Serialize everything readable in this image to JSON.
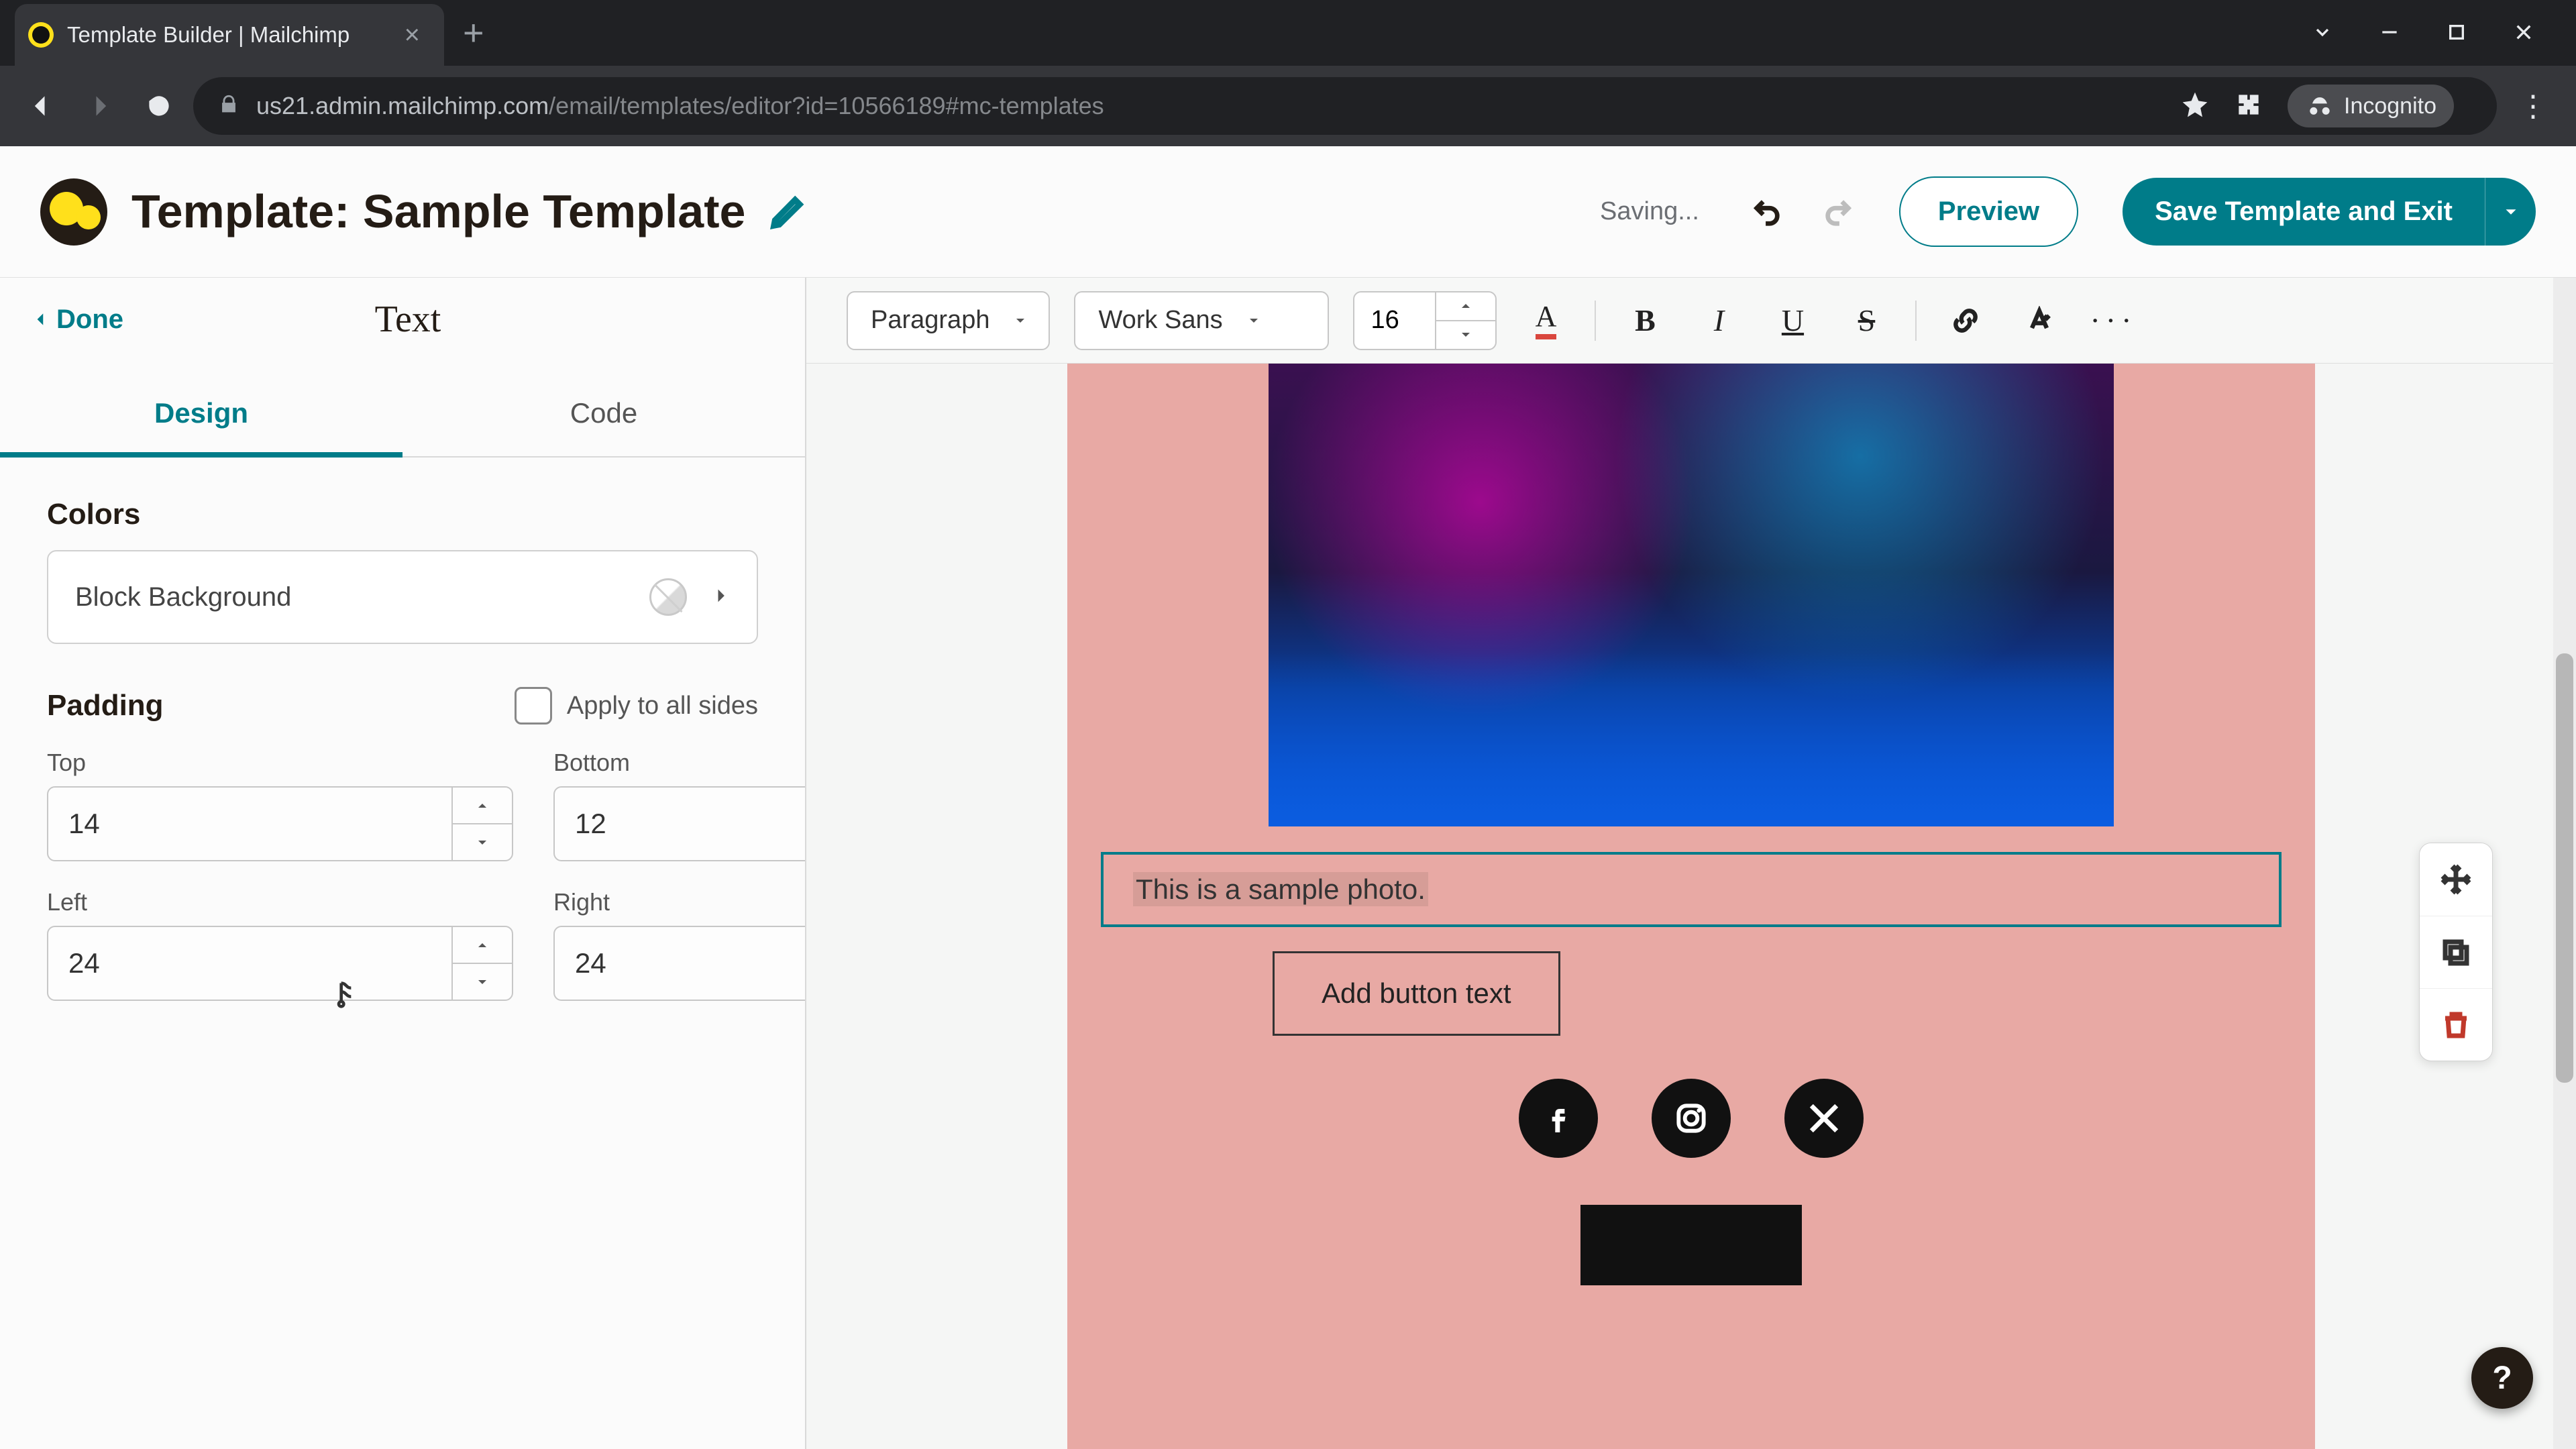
{
  "browser": {
    "tab_title": "Template Builder | Mailchimp",
    "url_host": "us21.admin.mailchimp.com",
    "url_path": "/email/templates/editor?id=10566189#mc-templates",
    "incognito_label": "Incognito"
  },
  "header": {
    "title_prefix": "Template: ",
    "template_name": "Sample Template",
    "saving_status": "Saving...",
    "preview_label": "Preview",
    "save_label": "Save Template and Exit"
  },
  "sidepanel": {
    "done_label": "Done",
    "title": "Text",
    "tabs": {
      "design": "Design",
      "code": "Code"
    },
    "colors_heading": "Colors",
    "block_bg_label": "Block Background",
    "padding_heading": "Padding",
    "apply_all_label": "Apply to all sides",
    "padding": {
      "top": {
        "label": "Top",
        "value": "14"
      },
      "bottom": {
        "label": "Bottom",
        "value": "12"
      },
      "left": {
        "label": "Left",
        "value": "24"
      },
      "right": {
        "label": "Right",
        "value": "24"
      }
    }
  },
  "rt": {
    "block_style": "Paragraph",
    "font": "Work Sans",
    "font_size": "16"
  },
  "canvas": {
    "sample_text": "This is a sample photo.",
    "button_text": "Add button text"
  },
  "help_label": "?"
}
